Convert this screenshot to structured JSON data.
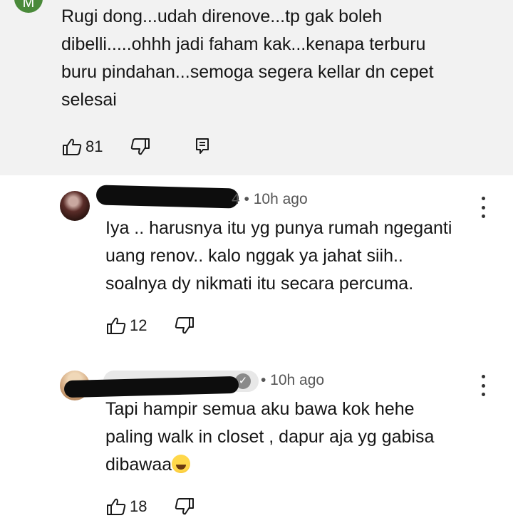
{
  "main_comment": {
    "avatar_letter": "M",
    "text": "Rugi dong...udah direnove...tp gak boleh\ndibelli.....ohhh jadi faham kak...kenapa terburu\nburu pindahan...semoga segera kellar dn cepet\nselesai",
    "like_count": "81"
  },
  "replies": [
    {
      "username_suffix": "4",
      "timestamp": "• 10h ago",
      "text": "Iya .. harusnya itu yg punya rumah ngeganti\nuang renov.. kalo nggak ya jahat siih..\nsoalnya dy nikmati itu secara percuma.",
      "like_count": "12"
    },
    {
      "timestamp": "• 10h ago",
      "text": "Tapi hampir semua aku bawa kok hehe\npaling walk in closet , dapur aja yg gabisa\ndibawaa",
      "like_count": "18"
    }
  ],
  "colors": {
    "top_background": "#f2f2f2",
    "avatar_green": "#4a8a3a",
    "text": "#151515",
    "meta": "#555555"
  },
  "icons": [
    "thumbs-up-icon",
    "thumbs-down-icon",
    "reply-icon",
    "more-vert-icon",
    "verified-check-icon",
    "grinning-sweat-emoji"
  ]
}
